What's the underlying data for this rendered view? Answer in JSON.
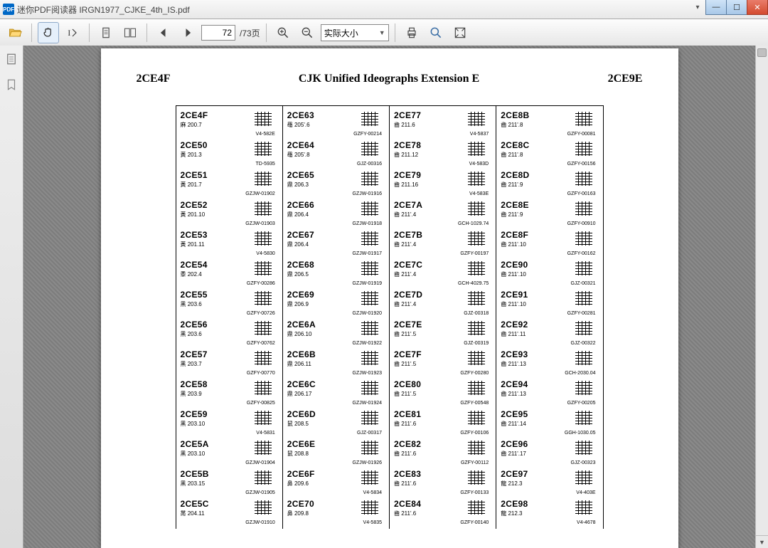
{
  "app": {
    "icon_text": "PDF",
    "title": "迷你PDF阅读器  IRGN1977_CJKE_4th_IS.pdf"
  },
  "toolbar": {
    "page_current": "72",
    "page_total": "/73页",
    "zoom_label": "实际大小"
  },
  "doc": {
    "head_left": "2CE4F",
    "head_mid": "CJK Unified Ideographs Extension E",
    "head_right": "2CE9E",
    "columns": [
      [
        {
          "code": "2CE4F",
          "rad": "麻 200.7",
          "src": "V4-582E"
        },
        {
          "code": "2CE50",
          "rad": "黃 201.3",
          "src": "TD-5935"
        },
        {
          "code": "2CE51",
          "rad": "黃 201.7",
          "src": "GZJW-01902"
        },
        {
          "code": "2CE52",
          "rad": "黃 201.10",
          "src": "GZJW-01903"
        },
        {
          "code": "2CE53",
          "rad": "黃 201.11",
          "src": "V4-5830"
        },
        {
          "code": "2CE54",
          "rad": "黍 202.4",
          "src": "GZFY-00286"
        },
        {
          "code": "2CE55",
          "rad": "黑 203.6",
          "src": "GZFY-00726"
        },
        {
          "code": "2CE56",
          "rad": "黑 203.6",
          "src": "GZFY-00762"
        },
        {
          "code": "2CE57",
          "rad": "黑 203.7",
          "src": "GZFY-00770"
        },
        {
          "code": "2CE58",
          "rad": "黑 203.9",
          "src": "GZFY-00825"
        },
        {
          "code": "2CE59",
          "rad": "黑 203.10",
          "src": "V4-5831"
        },
        {
          "code": "2CE5A",
          "rad": "黑 203.10",
          "src": "GZJW-01904"
        },
        {
          "code": "2CE5B",
          "rad": "黑 203.15",
          "src": "GZJW-01905"
        },
        {
          "code": "2CE5C",
          "rad": "黹 204.11",
          "src": "GZJW-01910"
        }
      ],
      [
        {
          "code": "2CE63",
          "rad": "黽 205'.6",
          "src": "GZFY-00214"
        },
        {
          "code": "2CE64",
          "rad": "黽 205'.8",
          "src": "GJZ-00316"
        },
        {
          "code": "2CE65",
          "rad": "鼎 206.3",
          "src": "GZJW-01916"
        },
        {
          "code": "2CE66",
          "rad": "鼎 206.4",
          "src": "GZJW-01918"
        },
        {
          "code": "2CE67",
          "rad": "鼎 206.4",
          "src": "GZJW-01917"
        },
        {
          "code": "2CE68",
          "rad": "鼎 206.5",
          "src": "GZJW-01919"
        },
        {
          "code": "2CE69",
          "rad": "鼎 206.9",
          "src": "GZJW-01920"
        },
        {
          "code": "2CE6A",
          "rad": "鼎 206.10",
          "src": "GZJW-01922"
        },
        {
          "code": "2CE6B",
          "rad": "鼎 206.11",
          "src": "GZJW-01923"
        },
        {
          "code": "2CE6C",
          "rad": "鼎 206.17",
          "src": "GZJW-01924"
        },
        {
          "code": "2CE6D",
          "rad": "鼠 208.5",
          "src": "GJZ-00317"
        },
        {
          "code": "2CE6E",
          "rad": "鼠 208.8",
          "src": "GZJW-01926"
        },
        {
          "code": "2CE6F",
          "rad": "鼻 209.6",
          "src": "V4-5834"
        },
        {
          "code": "2CE70",
          "rad": "鼻 209.8",
          "src": "V4-5835"
        }
      ],
      [
        {
          "code": "2CE77",
          "rad": "齒 211.6",
          "src": "V4-5837"
        },
        {
          "code": "2CE78",
          "rad": "齒 211.12",
          "src": "V4-583D"
        },
        {
          "code": "2CE79",
          "rad": "齒 211.16",
          "src": "V4-583E"
        },
        {
          "code": "2CE7A",
          "rad": "齒 211'.4",
          "src": "GCH-1029.74"
        },
        {
          "code": "2CE7B",
          "rad": "齒 211'.4",
          "src": "GZFY-00197"
        },
        {
          "code": "2CE7C",
          "rad": "齒 211'.4",
          "src": "GCH-4029.75"
        },
        {
          "code": "2CE7D",
          "rad": "齒 211'.4",
          "src": "GJZ-00318"
        },
        {
          "code": "2CE7E",
          "rad": "齒 211'.5",
          "src": "GJZ-00319"
        },
        {
          "code": "2CE7F",
          "rad": "齒 211'.5",
          "src": "GZFY-00280"
        },
        {
          "code": "2CE80",
          "rad": "齒 211'.5",
          "src": "GZFY-00548"
        },
        {
          "code": "2CE81",
          "rad": "齒 211'.6",
          "src": "GZFY-00106"
        },
        {
          "code": "2CE82",
          "rad": "齒 211'.6",
          "src": "GZFY-00112"
        },
        {
          "code": "2CE83",
          "rad": "齒 211'.6",
          "src": "GZFY-00133"
        },
        {
          "code": "2CE84",
          "rad": "齒 211'.6",
          "src": "GZFY-00140"
        }
      ],
      [
        {
          "code": "2CE8B",
          "rad": "齒 211'.8",
          "src": "GZFY-00081"
        },
        {
          "code": "2CE8C",
          "rad": "齒 211'.8",
          "src": "GZFY-00156"
        },
        {
          "code": "2CE8D",
          "rad": "齒 211'.9",
          "src": "GZFY-00163"
        },
        {
          "code": "2CE8E",
          "rad": "齒 211'.9",
          "src": "GZFY-00910"
        },
        {
          "code": "2CE8F",
          "rad": "齒 211'.10",
          "src": "GZFY-00162"
        },
        {
          "code": "2CE90",
          "rad": "齒 211'.10",
          "src": "GJZ-00321"
        },
        {
          "code": "2CE91",
          "rad": "齒 211'.10",
          "src": "GZFY-00281"
        },
        {
          "code": "2CE92",
          "rad": "齒 211'.11",
          "src": "GJZ-00322"
        },
        {
          "code": "2CE93",
          "rad": "齒 211'.13",
          "src": "GCH-2030.04"
        },
        {
          "code": "2CE94",
          "rad": "齒 211'.13",
          "src": "GZFY-00205"
        },
        {
          "code": "2CE95",
          "rad": "齒 211'.14",
          "src": "GGH-1030.05"
        },
        {
          "code": "2CE96",
          "rad": "齒 211'.17",
          "src": "GJZ-00323"
        },
        {
          "code": "2CE97",
          "rad": "龍 212.3",
          "src": "V4-403E"
        },
        {
          "code": "2CE98",
          "rad": "龍 212.3",
          "src": "V4-4678"
        }
      ]
    ]
  }
}
